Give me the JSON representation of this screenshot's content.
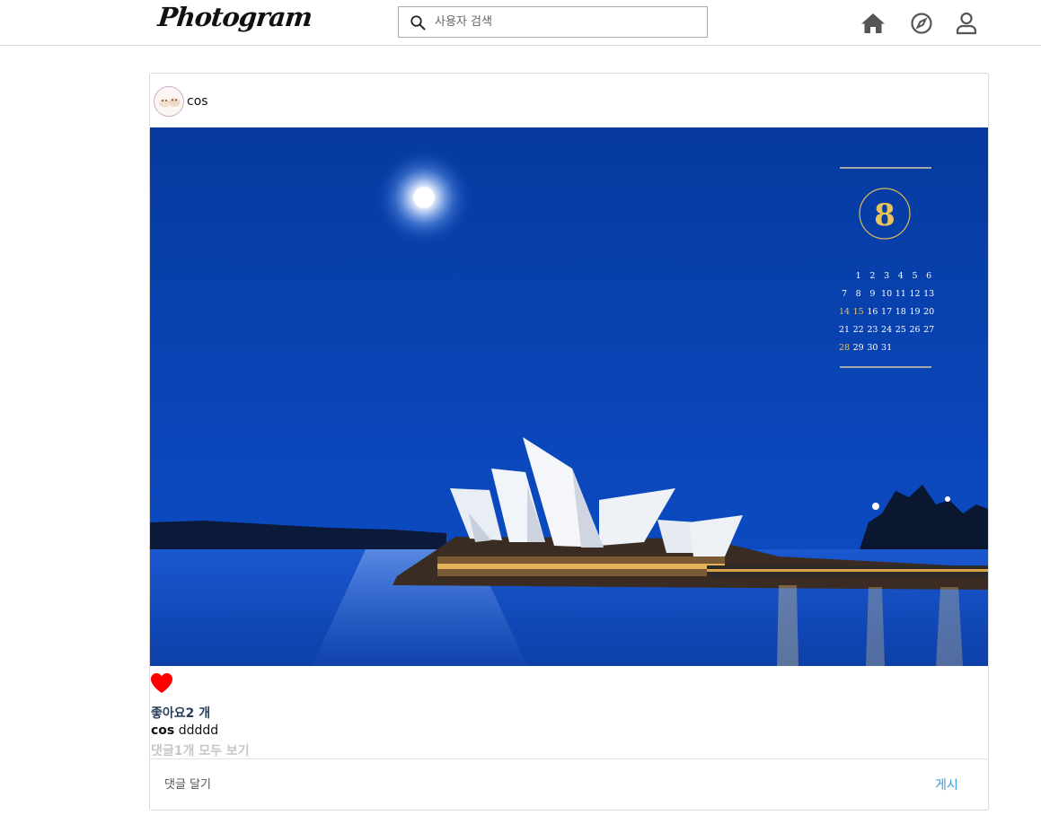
{
  "header": {
    "logo": "Photogram",
    "search": {
      "placeholder": "사용자 검색",
      "value": ""
    },
    "nav": [
      {
        "icon": "home-icon"
      },
      {
        "icon": "compass-icon"
      },
      {
        "icon": "user-icon"
      }
    ]
  },
  "post": {
    "username": "cos",
    "image": {
      "calendar": {
        "month": "8",
        "rows": [
          [
            "",
            "1",
            "2",
            "3",
            "4",
            "5",
            "6"
          ],
          [
            "7",
            "8",
            "9",
            "10",
            "11",
            "12",
            "13"
          ],
          [
            "14",
            "15",
            "16",
            "17",
            "18",
            "19",
            "20"
          ],
          [
            "21",
            "22",
            "23",
            "24",
            "25",
            "26",
            "27"
          ],
          [
            "28",
            "29",
            "30",
            "31",
            "",
            "",
            ""
          ]
        ]
      }
    },
    "like_icon": "heart-icon",
    "likes_text": "좋아요2 개",
    "caption_user": "cos",
    "caption_text": "ddddd",
    "view_comments": "댓글1개 모두 보기",
    "comment": {
      "placeholder": "댓글 달기",
      "value": ""
    },
    "post_button": "게시"
  },
  "colors": {
    "heart": "#ff0000",
    "post_button": "#3b9fd6",
    "likes": "#2a3f5a",
    "sky": "#0a45b5",
    "calendar_gold": "#e8c35a"
  }
}
